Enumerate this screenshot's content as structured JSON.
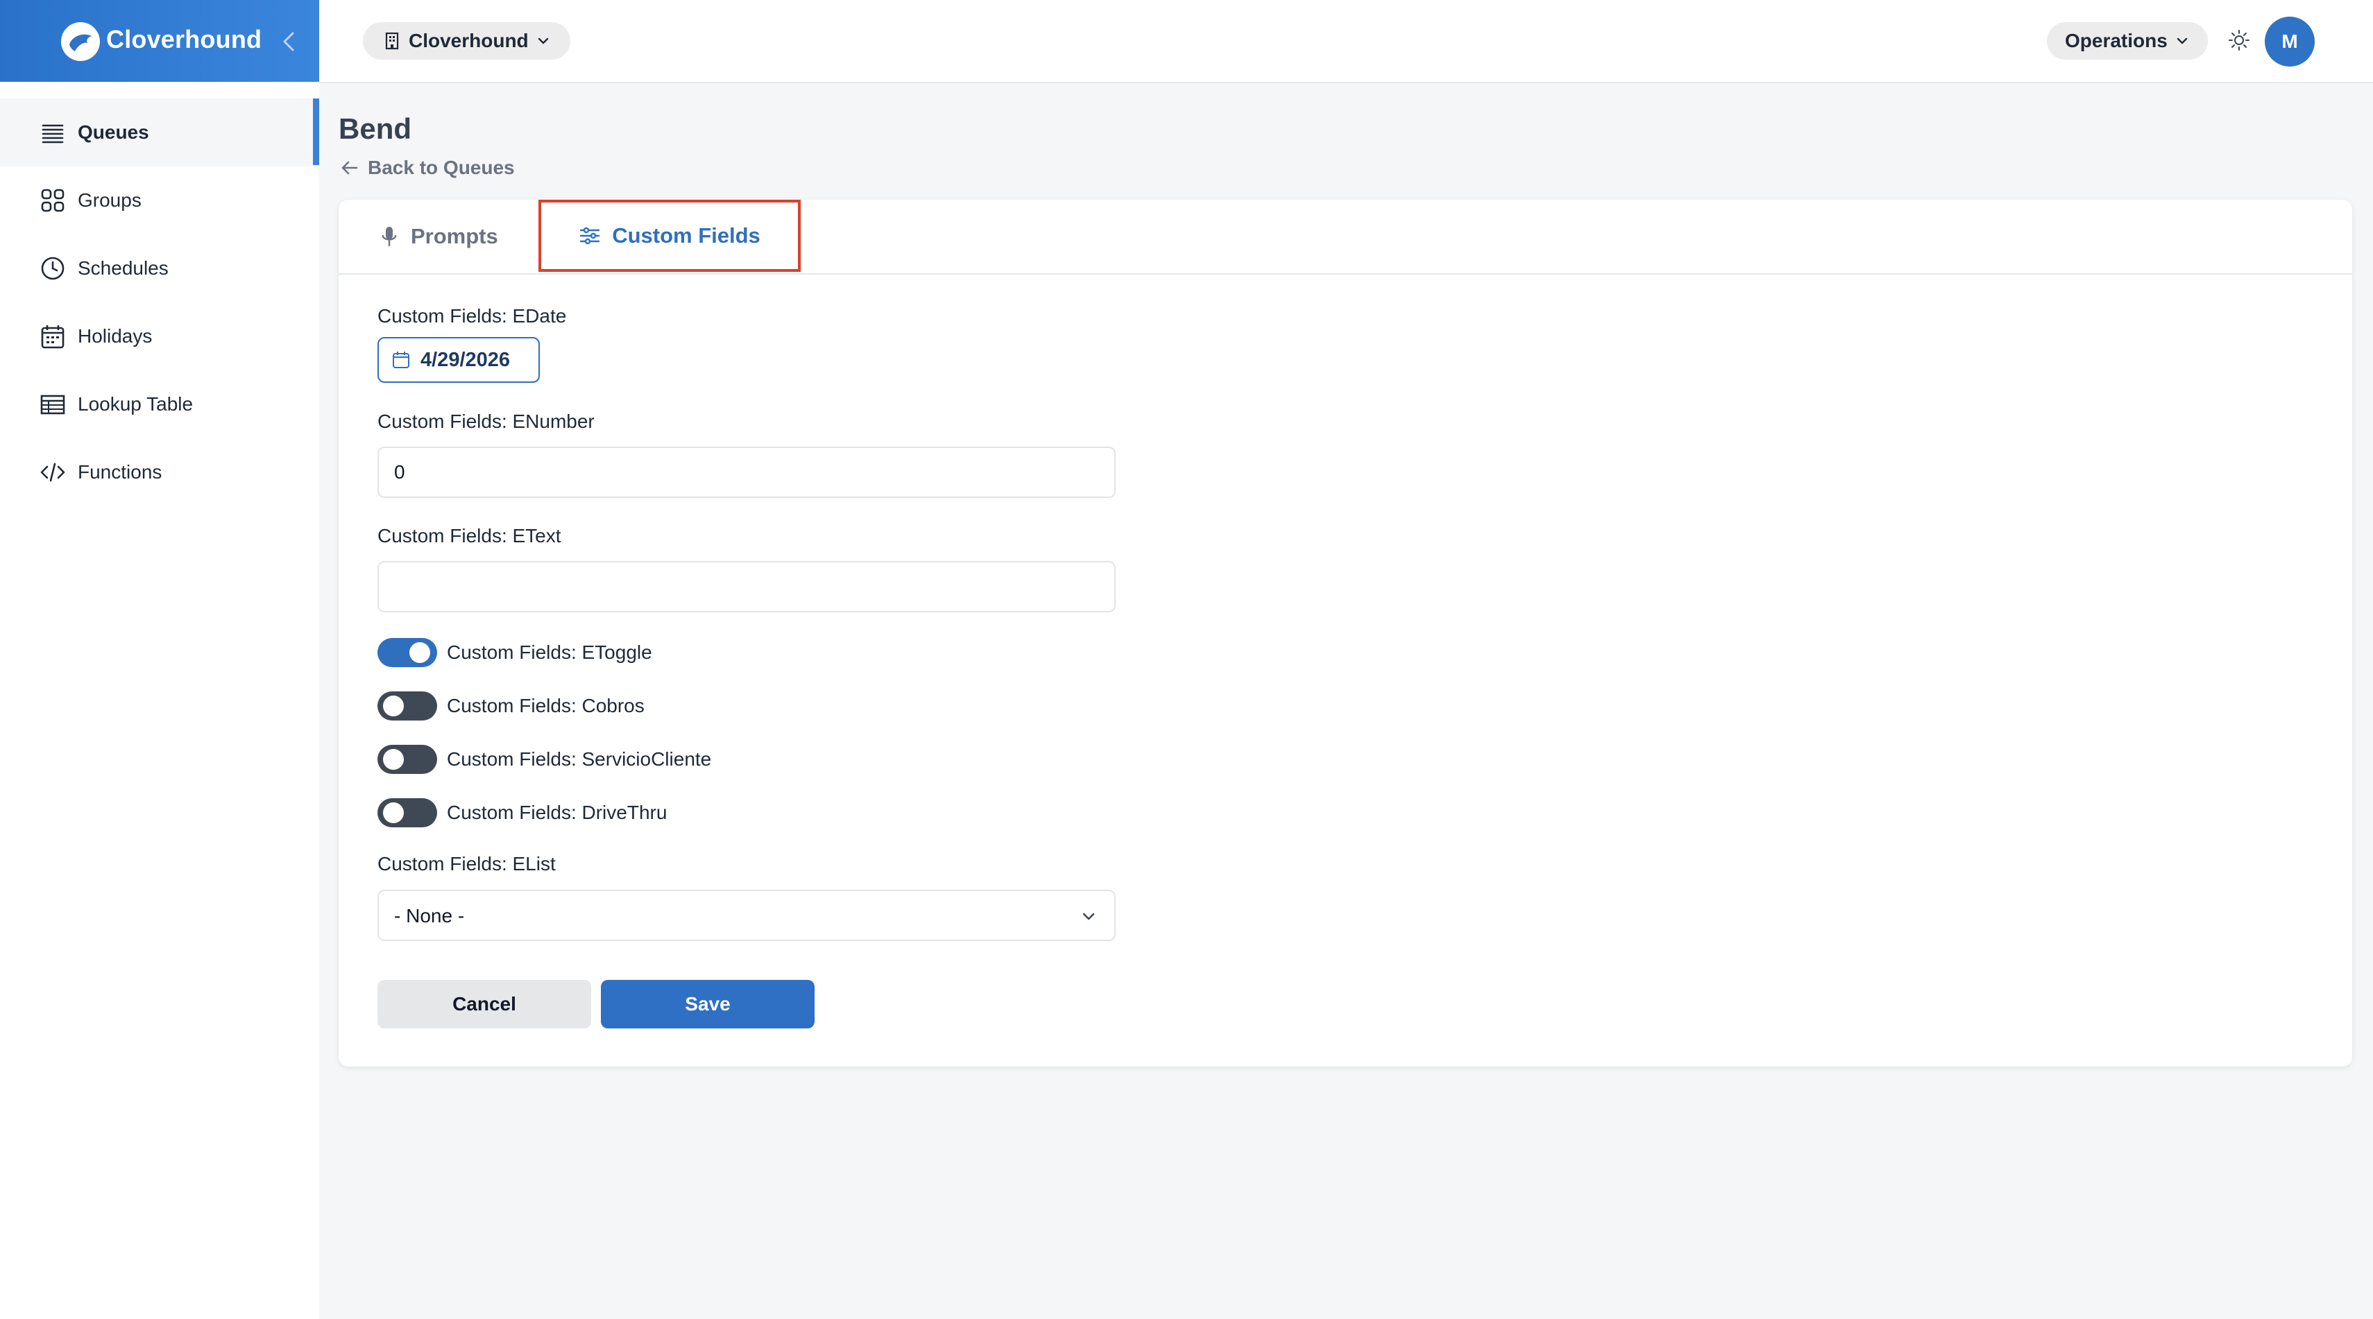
{
  "brand": {
    "name": "Cloverhound"
  },
  "sidebar": {
    "items": [
      {
        "label": "Queues",
        "icon": "list-icon",
        "active": true
      },
      {
        "label": "Groups",
        "icon": "grid-icon"
      },
      {
        "label": "Schedules",
        "icon": "clock-icon"
      },
      {
        "label": "Holidays",
        "icon": "calendar-icon"
      },
      {
        "label": "Lookup Table",
        "icon": "table-icon"
      },
      {
        "label": "Functions",
        "icon": "code-icon"
      }
    ]
  },
  "topbar": {
    "org_label": "Cloverhound",
    "role_label": "Operations",
    "avatar_initial": "M"
  },
  "page": {
    "title": "Bend",
    "back_label": "Back to Queues"
  },
  "tabs": [
    {
      "label": "Prompts",
      "icon": "microphone-icon"
    },
    {
      "label": "Custom Fields",
      "icon": "sliders-icon",
      "selected": true
    }
  ],
  "form": {
    "date_label": "Custom Fields: EDate",
    "date_value": "4/29/2026",
    "number_label": "Custom Fields: ENumber",
    "number_value": "0",
    "text_label": "Custom Fields: EText",
    "text_value": "",
    "toggles": [
      {
        "label": "Custom Fields: EToggle",
        "on": true
      },
      {
        "label": "Custom Fields: Cobros",
        "on": false
      },
      {
        "label": "Custom Fields: ServicioCliente",
        "on": false
      },
      {
        "label": "Custom Fields: DriveThru",
        "on": false
      }
    ],
    "list_label": "Custom Fields: EList",
    "list_value": "- None -",
    "cancel_label": "Cancel",
    "save_label": "Save"
  },
  "colors": {
    "accent": "#2f6fbd",
    "highlight_border": "#d9412e",
    "toggle_off": "#3f4955"
  }
}
